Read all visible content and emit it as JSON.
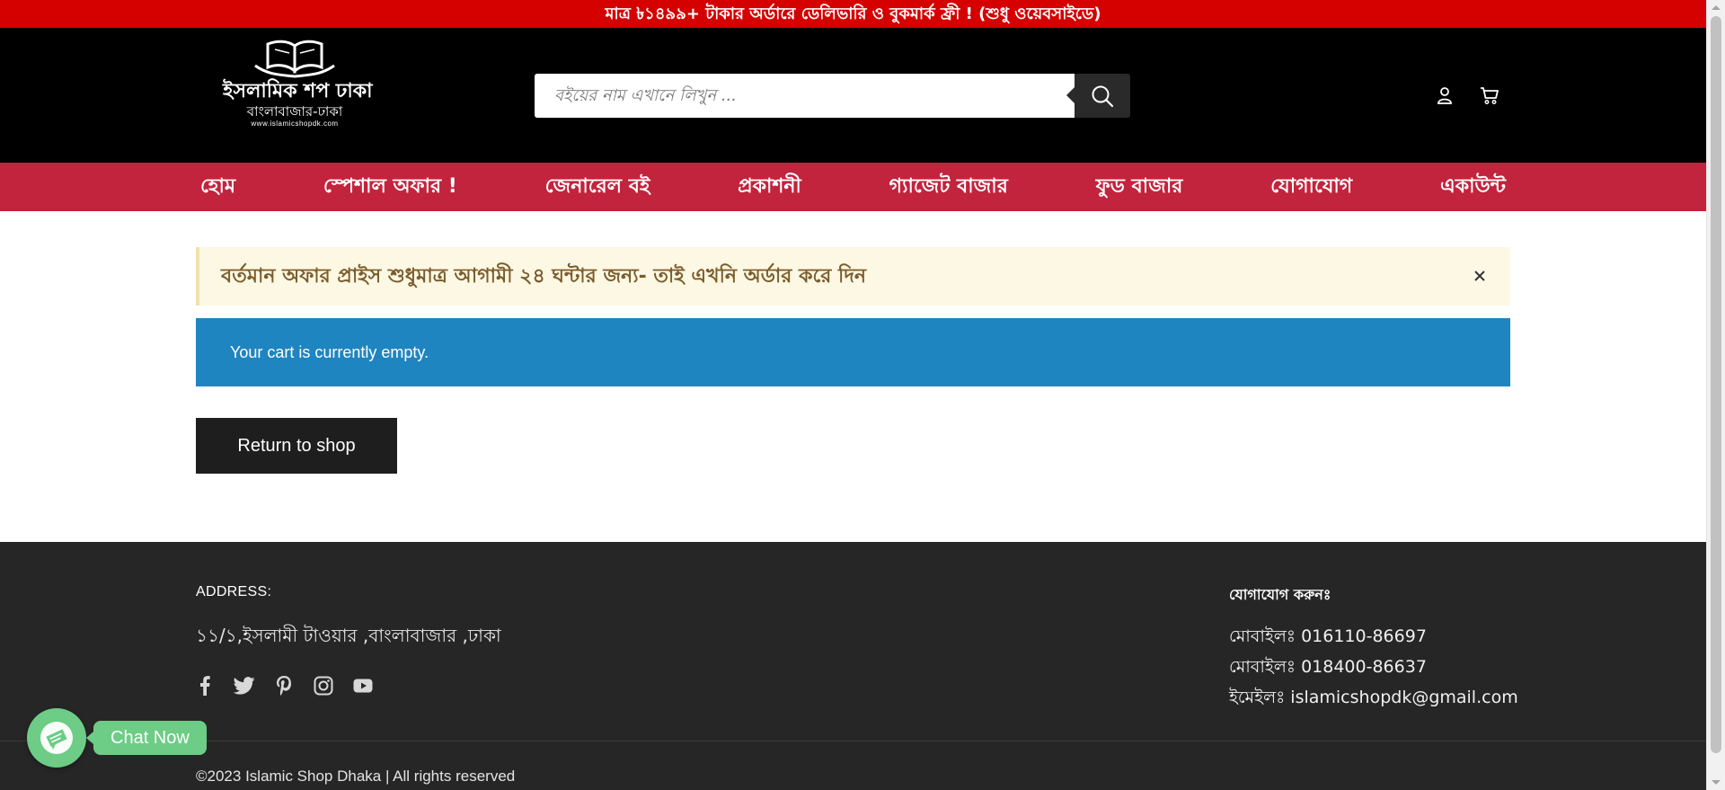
{
  "topbar": {
    "text": "মাত্র ৳১৪৯৯+ টাকার অর্ডারে ডেলিভারি ও বুকমার্ক ফ্রী ! (শুধু ওয়েবসাইডে)"
  },
  "header": {
    "logo": {
      "main": "ইসলামিক শপ ঢাকা",
      "sub": "বাংলাবাজার-ঢাকা",
      "url": "www.islamicshopdk.com"
    },
    "search": {
      "placeholder": "বইয়ের নাম এখানে লিখুন ..."
    },
    "icons": [
      "user-icon",
      "cart-icon",
      "search-icon"
    ]
  },
  "nav": {
    "items": [
      "হোম",
      "স্পেশাল অফার !",
      "জেনারেল বই",
      "প্রকাশনী",
      "গ্যাজেট বাজার",
      "ফুড বাজার",
      "যোগাযোগ",
      "একাউন্ট"
    ]
  },
  "notice": {
    "text": "বর্তমান অফার প্রাইস শুধুমাত্র আগামী ২৪ ঘন্টার জন্য- তাই এখনি অর্ডার করে দিন"
  },
  "cart": {
    "empty_message": "Your cart is currently empty.",
    "return_label": "Return to shop"
  },
  "footer": {
    "address_label": "ADDRESS:",
    "address": "১১/১,ইসলামী টাওয়ার ,বাংলাবাজার ,ঢাকা",
    "social_icons": [
      "facebook-icon",
      "twitter-icon",
      "pinterest-icon",
      "instagram-icon",
      "youtube-icon"
    ],
    "contact_title": "যোগাযোগ করুনঃ",
    "mobile_label": "মোবাইলঃ",
    "mobile1": "016110-86697",
    "mobile2": "018400-86637",
    "email_label": "ইমেইলঃ",
    "email": "islamicshopdk@gmail.com",
    "copyright": "©2023 Islamic Shop Dhaka | All rights reserved"
  },
  "chat": {
    "label": "Chat Now"
  },
  "colors": {
    "topbar": "#d50000",
    "header": "#000000",
    "nav": "#c2243d",
    "notice_bg": "#fdf8e4",
    "notice_text": "#7b5c2b",
    "info": "#1e85c0",
    "button": "#1e1e1e",
    "footer": "#262626",
    "chat": "#6dcc85"
  }
}
